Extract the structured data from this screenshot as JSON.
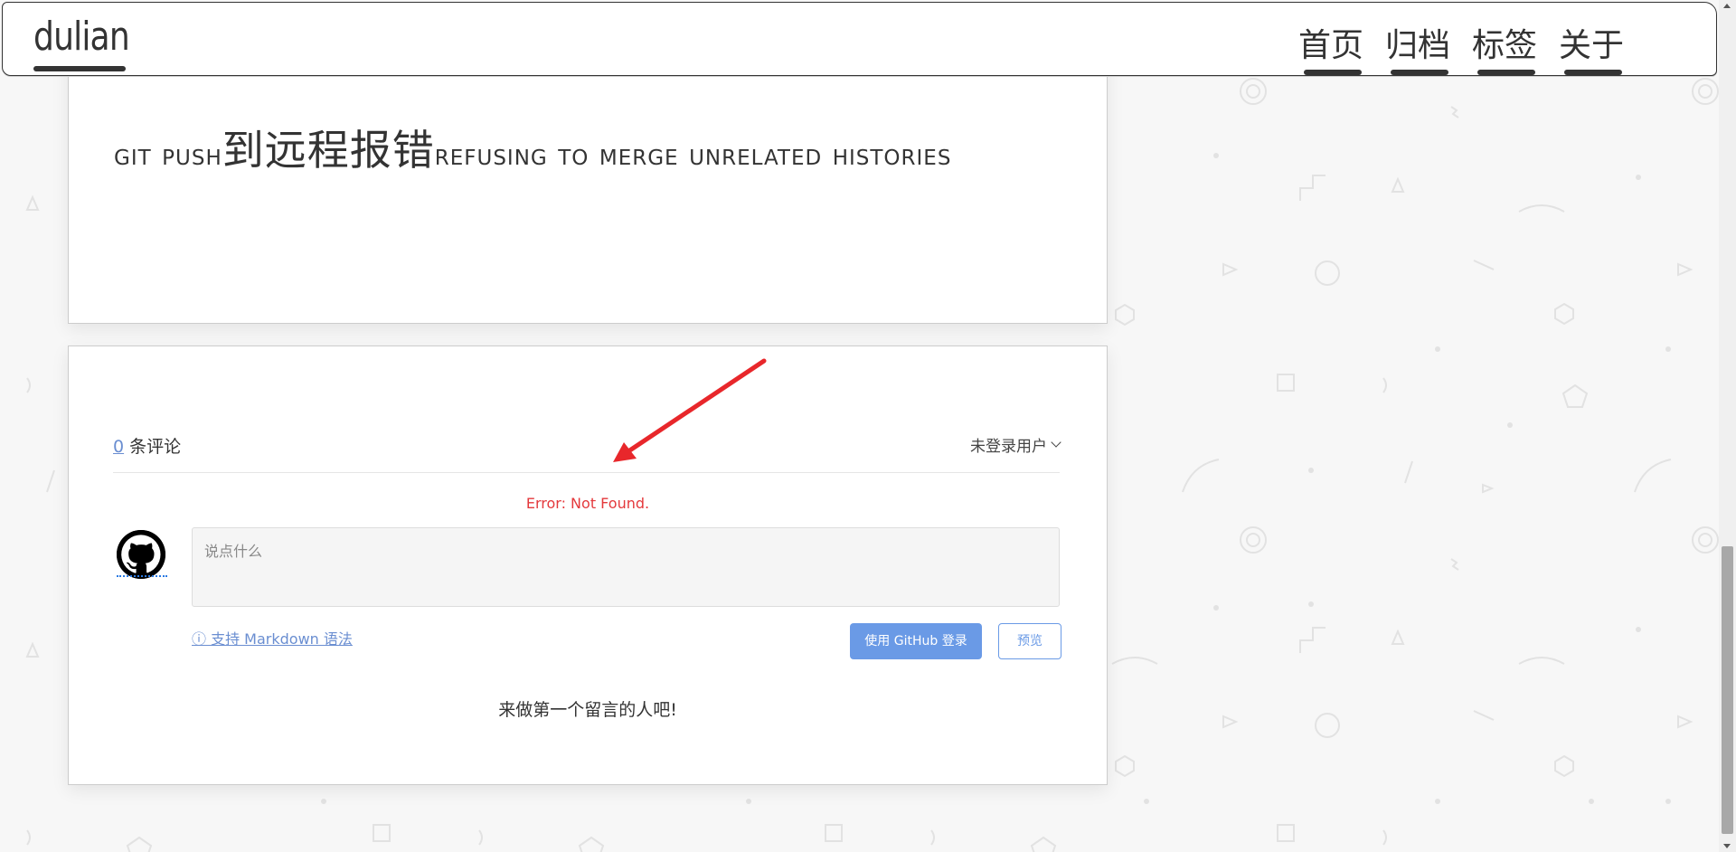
{
  "header": {
    "logo": "dulian",
    "nav": [
      "首页",
      "归档",
      "标签",
      "关于"
    ]
  },
  "post": {
    "title_parts": [
      "git push",
      "到远程报错",
      "refusing to merge unrelated histories"
    ]
  },
  "comments": {
    "count": "0",
    "count_label": " 条评论",
    "login_menu": "未登录用户",
    "error": "Error: Not Found.",
    "placeholder": "说点什么",
    "markdown_link": "ⓘ 支持 Markdown 语法",
    "login_button": "使用 GitHub 登录",
    "preview_button": "预览",
    "empty_text": "来做第一个留言的人吧!"
  },
  "colors": {
    "link": "#6a8ed1",
    "error": "#e4393c",
    "primary_button": "#6a9ae6",
    "arrow": "#e8272b"
  }
}
